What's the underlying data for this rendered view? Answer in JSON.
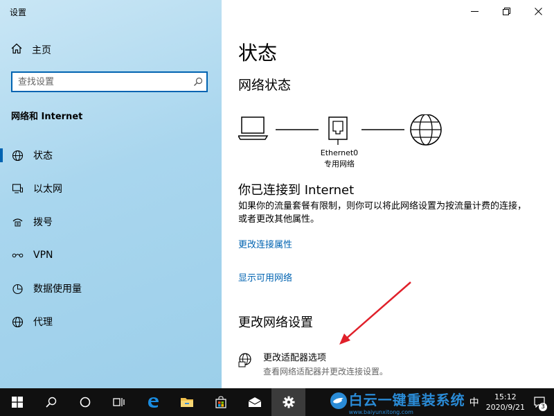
{
  "window": {
    "title": "设置"
  },
  "sidebar": {
    "home_label": "主页",
    "search_placeholder": "查找设置",
    "section_title": "网络和 Internet",
    "items": [
      {
        "label": "状态",
        "icon": "globe-icon",
        "active": true
      },
      {
        "label": "以太网",
        "icon": "monitor-icon"
      },
      {
        "label": "拨号",
        "icon": "dialup-icon"
      },
      {
        "label": "VPN",
        "icon": "vpn-icon"
      },
      {
        "label": "数据使用量",
        "icon": "data-usage-icon"
      },
      {
        "label": "代理",
        "icon": "globe-icon"
      }
    ]
  },
  "main": {
    "page_title": "状态",
    "network_status_title": "网络状态",
    "network_name": "Ethernet0",
    "network_type": "专用网络",
    "connected_title": "你已连接到 Internet",
    "description": "如果你的流量套餐有限制，则你可以将此网络设置为按流量计费的连接，或者更改其他属性。",
    "link_change_properties": "更改连接属性",
    "link_show_networks": "显示可用网络",
    "change_settings_title": "更改网络设置",
    "adapter_option": {
      "title": "更改适配器选项",
      "subtitle": "查看网络适配器并更改连接设置。"
    }
  },
  "taskbar": {
    "apps": [
      "windows-start-icon",
      "search-icon",
      "cortana-icon",
      "task-view-icon",
      "edge-icon",
      "file-explorer-icon",
      "store-icon",
      "mail-icon",
      "settings-icon"
    ],
    "ime": "中",
    "clock_time": "15:12",
    "clock_date": "2020/9/21",
    "notification_count": "3",
    "watermark_text": "白云一键重装系统",
    "watermark_url": "www.baiyunxitong.com"
  },
  "colors": {
    "accent": "#0063b1",
    "arrow": "#e0202a"
  }
}
